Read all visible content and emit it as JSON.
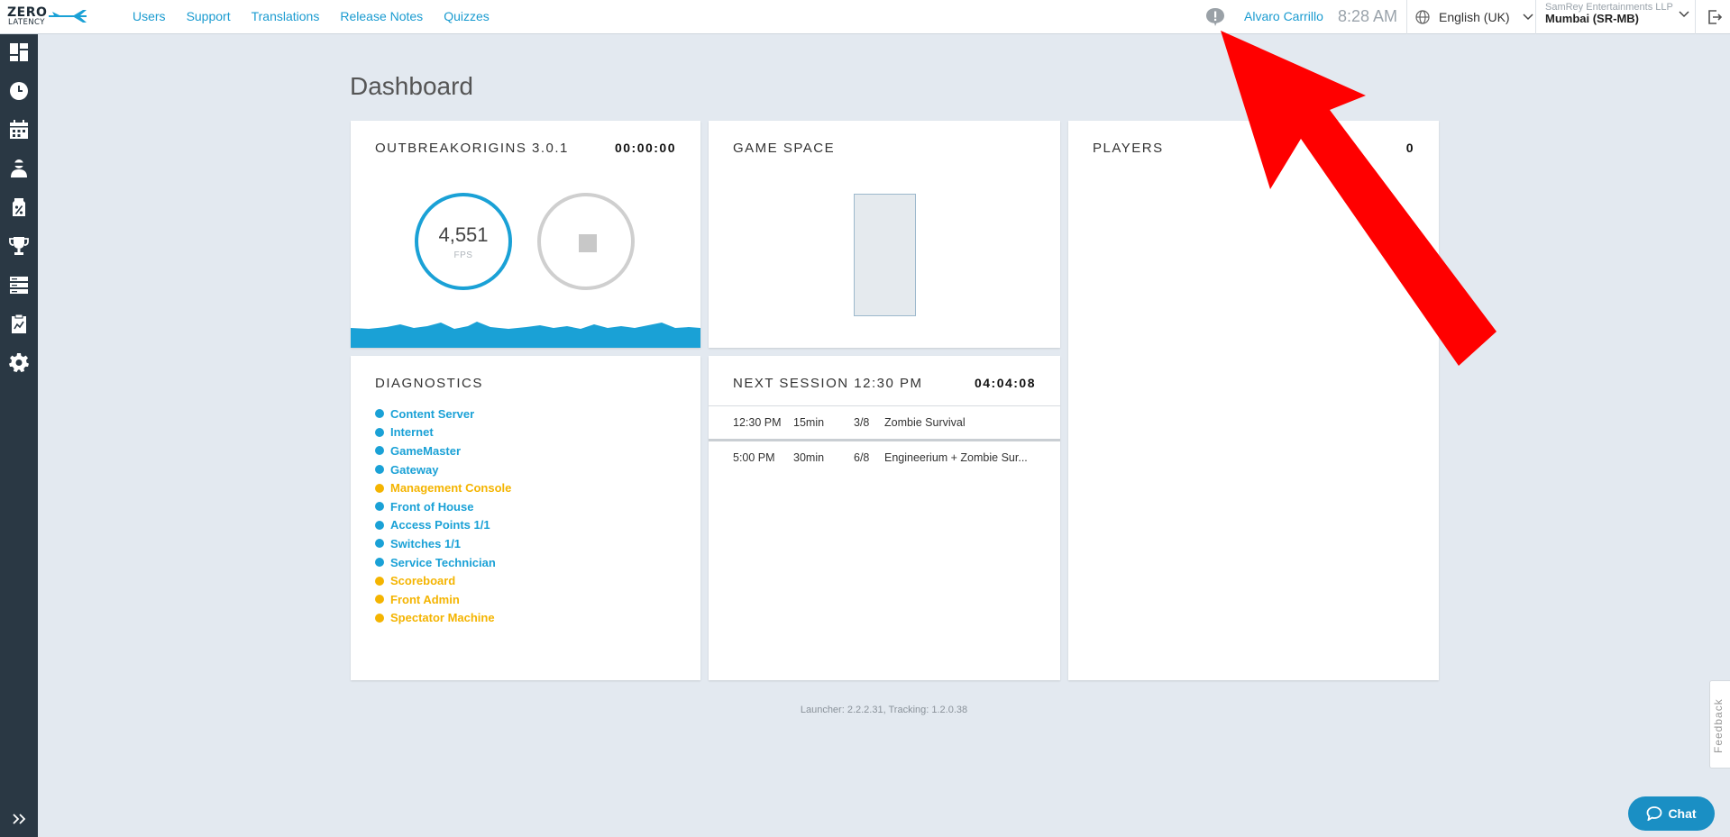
{
  "brand": {
    "line1": "ZERO",
    "line2": "LATENCY"
  },
  "nav": [
    "Users",
    "Support",
    "Translations",
    "Release Notes",
    "Quizzes"
  ],
  "header": {
    "username": "Alvaro Carrillo",
    "time": "8:28 AM",
    "language": "English (UK)",
    "organization": "SamRey Entertainments LLP",
    "location": "Mumbai (SR-MB)"
  },
  "page_title": "Dashboard",
  "game_card": {
    "title": "OUTBREAKORIGINS 3.0.1",
    "timer": "00:00:00",
    "fps_value": "4,551",
    "fps_label": "FPS"
  },
  "game_space": {
    "title": "GAME SPACE"
  },
  "players": {
    "title": "PLAYERS",
    "count": "0"
  },
  "diagnostics": {
    "title": "DIAGNOSTICS",
    "items": [
      {
        "label": "Content Server",
        "status": "ok"
      },
      {
        "label": "Internet",
        "status": "ok"
      },
      {
        "label": "GameMaster",
        "status": "ok"
      },
      {
        "label": "Gateway",
        "status": "ok"
      },
      {
        "label": "Management Console",
        "status": "warning"
      },
      {
        "label": "Front of House",
        "status": "ok"
      },
      {
        "label": "Access Points 1/1",
        "status": "ok"
      },
      {
        "label": "Switches 1/1",
        "status": "ok"
      },
      {
        "label": "Service Technician",
        "status": "ok"
      },
      {
        "label": "Scoreboard",
        "status": "warning"
      },
      {
        "label": "Front Admin",
        "status": "warning"
      },
      {
        "label": "Spectator Machine",
        "status": "warning"
      }
    ]
  },
  "next_session": {
    "title": "NEXT SESSION 12:30 PM",
    "countdown": "04:04:08",
    "rows": [
      {
        "time": "12:30 PM",
        "duration": "15min",
        "players": "3/8",
        "game": "Zombie Survival"
      },
      {
        "time": "5:00 PM",
        "duration": "30min",
        "players": "6/8",
        "game": "Engineerium + Zombie Sur..."
      }
    ]
  },
  "footer": "Launcher: 2.2.2.31, Tracking: 1.2.0.38",
  "feedback_label": "Feedback",
  "chat_label": "Chat",
  "colors": {
    "accent": "#1aa1d6",
    "ok": "#1aa1d6",
    "warning": "#f4b400",
    "sidebar": "#2a3844",
    "arrow": "#ff0000"
  },
  "sidebar_icons": [
    "dashboard-icon",
    "clock-icon",
    "calendar-icon",
    "vr-player-icon",
    "voucher-icon",
    "trophy-icon",
    "server-icon",
    "report-icon",
    "settings-icon"
  ]
}
